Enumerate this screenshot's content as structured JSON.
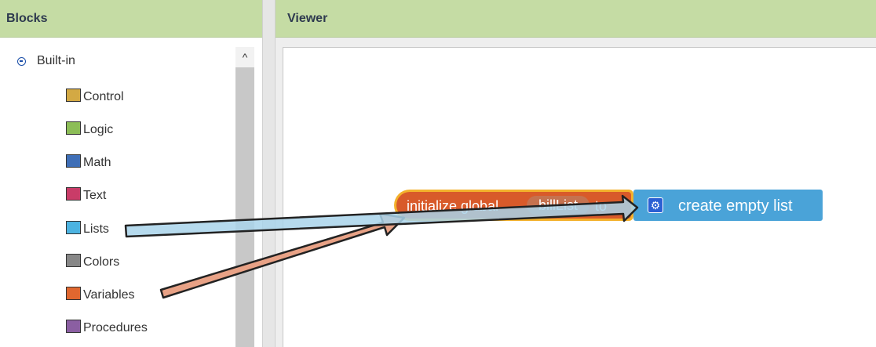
{
  "blocks_panel": {
    "title": "Blocks",
    "builtin_label": "Built-in",
    "categories": [
      {
        "label": "Control",
        "color": "#d3a944"
      },
      {
        "label": "Logic",
        "color": "#8cbd57"
      },
      {
        "label": "Math",
        "color": "#3f6fb7"
      },
      {
        "label": "Text",
        "color": "#c93c68"
      },
      {
        "label": "Lists",
        "color": "#4cb3e1"
      },
      {
        "label": "Colors",
        "color": "#878787"
      },
      {
        "label": "Variables",
        "color": "#e0672f"
      },
      {
        "label": "Procedures",
        "color": "#8b5fa2"
      }
    ],
    "scroll_up_glyph": "^"
  },
  "viewer": {
    "title": "Viewer",
    "init_block": {
      "prefix": "initialize global",
      "var_name": "billList",
      "suffix": "to"
    },
    "list_block": {
      "label": "create empty list",
      "icon": "gear-icon"
    }
  },
  "colors": {
    "header_bg": "#c5dca4",
    "variables_block": "#d85a2a",
    "lists_block": "#4aa3d8",
    "arrow_lists": "#a9d3ea",
    "arrow_variables": "#e8a286"
  }
}
